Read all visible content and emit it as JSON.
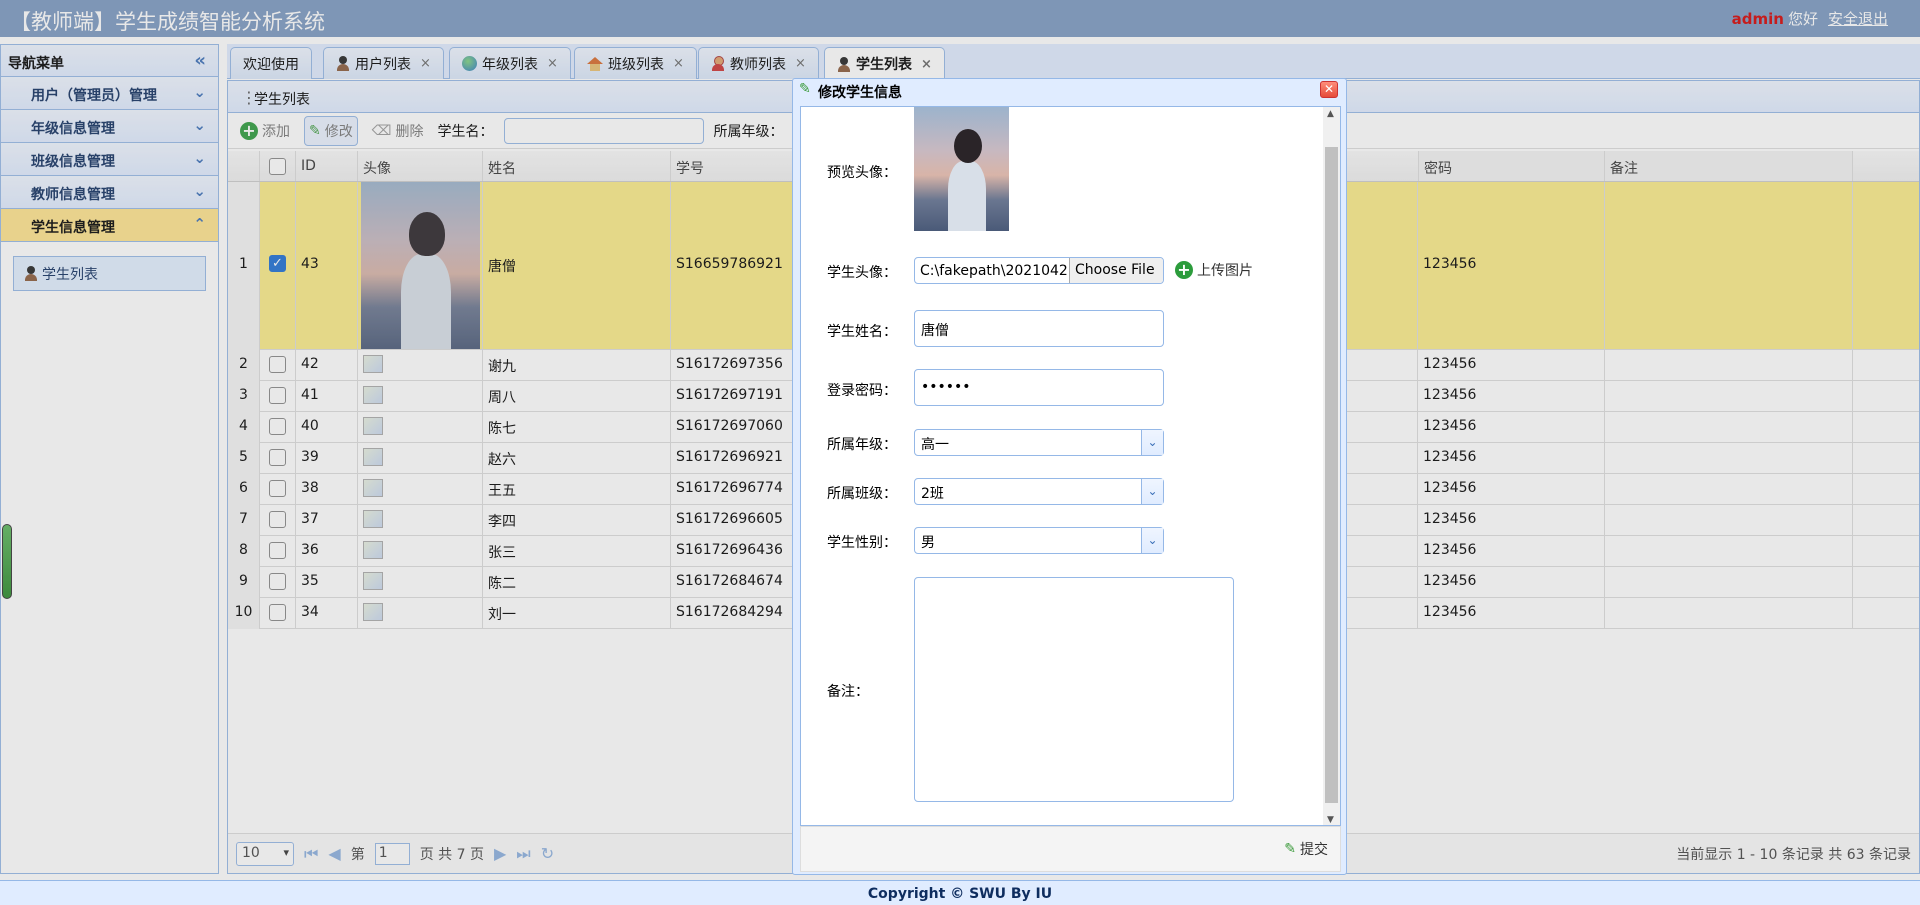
{
  "header": {
    "title": "【教师端】学生成绩智能分析系统",
    "user": "admin",
    "greeting": "您好",
    "logout": "安全退出"
  },
  "nav": {
    "title": "导航菜单",
    "items": [
      {
        "label": "用户（管理员）管理"
      },
      {
        "label": "年级信息管理"
      },
      {
        "label": "班级信息管理"
      },
      {
        "label": "教师信息管理"
      },
      {
        "label": "学生信息管理"
      }
    ],
    "sub_item": "学生列表"
  },
  "tabs": [
    {
      "label": "欢迎使用"
    },
    {
      "label": "用户列表"
    },
    {
      "label": "年级列表"
    },
    {
      "label": "班级列表"
    },
    {
      "label": "教师列表"
    },
    {
      "label": "学生列表"
    }
  ],
  "panel": {
    "title": "学生列表",
    "toolbar": {
      "add": "添加",
      "edit": "修改",
      "delete": "删除",
      "name_label": "学生名：",
      "grade_label": "所属年级："
    }
  },
  "grid": {
    "columns": [
      "ID",
      "头像",
      "姓名",
      "学号",
      "密码",
      "备注"
    ],
    "rows": [
      {
        "n": "1",
        "id": "43",
        "name": "唐僧",
        "sn": "S16659786921",
        "pwd": "123456"
      },
      {
        "n": "2",
        "id": "42",
        "name": "谢九",
        "sn": "S16172697356",
        "pwd": "123456"
      },
      {
        "n": "3",
        "id": "41",
        "name": "周八",
        "sn": "S16172697191",
        "pwd": "123456"
      },
      {
        "n": "4",
        "id": "40",
        "name": "陈七",
        "sn": "S16172697060",
        "pwd": "123456"
      },
      {
        "n": "5",
        "id": "39",
        "name": "赵六",
        "sn": "S16172696921",
        "pwd": "123456"
      },
      {
        "n": "6",
        "id": "38",
        "name": "王五",
        "sn": "S16172696774",
        "pwd": "123456"
      },
      {
        "n": "7",
        "id": "37",
        "name": "李四",
        "sn": "S16172696605",
        "pwd": "123456"
      },
      {
        "n": "8",
        "id": "36",
        "name": "张三",
        "sn": "S16172696436",
        "pwd": "123456"
      },
      {
        "n": "9",
        "id": "35",
        "name": "陈二",
        "sn": "S16172684674",
        "pwd": "123456"
      },
      {
        "n": "10",
        "id": "34",
        "name": "刘一",
        "sn": "S16172684294",
        "pwd": "123456"
      }
    ]
  },
  "pager": {
    "page_size": "10",
    "page_prefix": "第",
    "page": "1",
    "page_suffix": "页 共 7 页",
    "info": "当前显示 1 - 10 条记录 共 63 条记录"
  },
  "dialog": {
    "title": "修改学生信息",
    "preview_label": "预览头像：",
    "photo_label": "学生头像：",
    "file_path": "C:\\fakepath\\2021042",
    "choose_file": "Choose File",
    "upload": "上传图片",
    "name_label": "学生姓名：",
    "name_value": "唐僧",
    "password_label": "登录密码：",
    "password_value": "••••••",
    "grade_label": "所属年级：",
    "grade_value": "高一",
    "class_label": "所属班级：",
    "class_value": "2班",
    "gender_label": "学生性别：",
    "gender_value": "男",
    "remark_label": "备注：",
    "submit": "提交"
  },
  "footer": {
    "text": "Copyright © SWU By IU"
  }
}
